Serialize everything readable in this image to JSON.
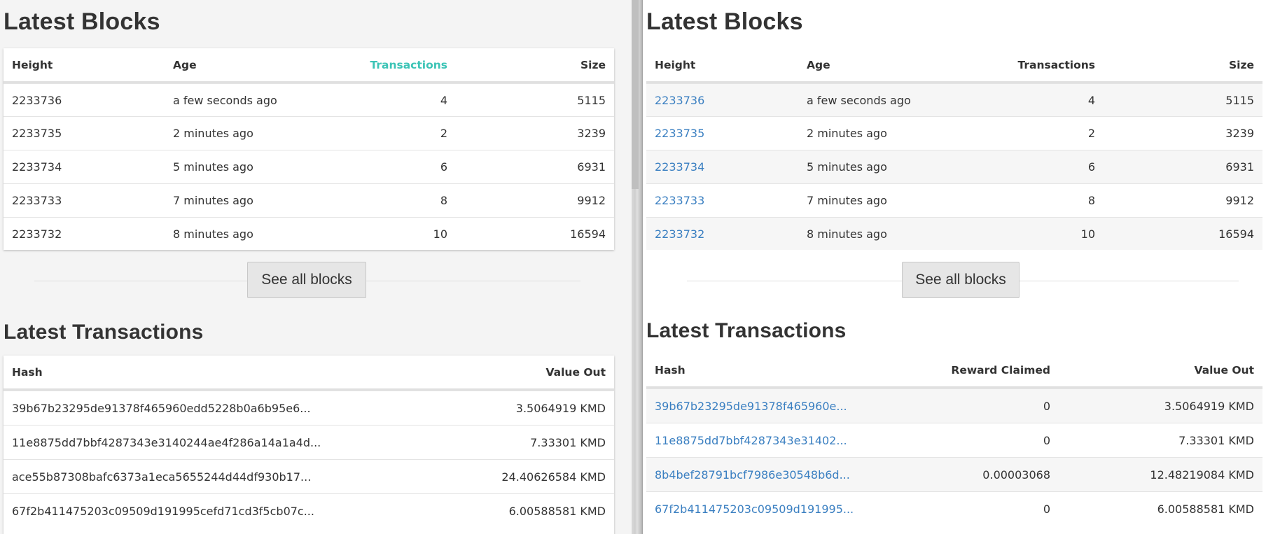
{
  "left": {
    "blocks_title": "Latest Blocks",
    "blocks_headers": {
      "height": "Height",
      "age": "Age",
      "transactions": "Transactions",
      "size": "Size"
    },
    "blocks": [
      {
        "height": "2233736",
        "age": "a few seconds ago",
        "transactions": "4",
        "size": "5115"
      },
      {
        "height": "2233735",
        "age": "2 minutes ago",
        "transactions": "2",
        "size": "3239"
      },
      {
        "height": "2233734",
        "age": "5 minutes ago",
        "transactions": "6",
        "size": "6931"
      },
      {
        "height": "2233733",
        "age": "7 minutes ago",
        "transactions": "8",
        "size": "9912"
      },
      {
        "height": "2233732",
        "age": "8 minutes ago",
        "transactions": "10",
        "size": "16594"
      }
    ],
    "see_all_label": "See all blocks",
    "tx_title": "Latest Transactions",
    "tx_headers": {
      "hash": "Hash",
      "value_out": "Value Out"
    },
    "transactions": [
      {
        "hash": "39b67b23295de91378f465960edd5228b0a6b95e6...",
        "value_out": "3.5064919 KMD"
      },
      {
        "hash": "11e8875dd7bbf4287343e3140244ae4f286a14a1a4d...",
        "value_out": "7.33301 KMD"
      },
      {
        "hash": "ace55b87308bafc6373a1eca5655244d44df930b17...",
        "value_out": "24.40626584 KMD"
      },
      {
        "hash": "67f2b411475203c09509d191995cefd71cd3f5cb07c...",
        "value_out": "6.00588581 KMD"
      }
    ]
  },
  "right": {
    "blocks_title": "Latest Blocks",
    "blocks_headers": {
      "height": "Height",
      "age": "Age",
      "transactions": "Transactions",
      "size": "Size"
    },
    "blocks": [
      {
        "height": "2233736",
        "age": "a few seconds ago",
        "transactions": "4",
        "size": "5115"
      },
      {
        "height": "2233735",
        "age": "2 minutes ago",
        "transactions": "2",
        "size": "3239"
      },
      {
        "height": "2233734",
        "age": "5 minutes ago",
        "transactions": "6",
        "size": "6931"
      },
      {
        "height": "2233733",
        "age": "7 minutes ago",
        "transactions": "8",
        "size": "9912"
      },
      {
        "height": "2233732",
        "age": "8 minutes ago",
        "transactions": "10",
        "size": "16594"
      }
    ],
    "see_all_label": "See all blocks",
    "tx_title": "Latest Transactions",
    "tx_headers": {
      "hash": "Hash",
      "reward_claimed": "Reward Claimed",
      "value_out": "Value Out"
    },
    "transactions": [
      {
        "hash": "39b67b23295de91378f465960e...",
        "reward_claimed": "0",
        "value_out": "3.5064919 KMD"
      },
      {
        "hash": "11e8875dd7bbf4287343e31402...",
        "reward_claimed": "0",
        "value_out": "7.33301 KMD"
      },
      {
        "hash": "8b4bef28791bcf7986e30548b6d...",
        "reward_claimed": "0.00003068",
        "value_out": "12.48219084 KMD"
      },
      {
        "hash": "67f2b411475203c09509d191995...",
        "reward_claimed": "0",
        "value_out": "6.00588581 KMD"
      }
    ]
  },
  "colors": {
    "active_sort_header": "#3cc4b6",
    "link": "#3a7fc1"
  }
}
